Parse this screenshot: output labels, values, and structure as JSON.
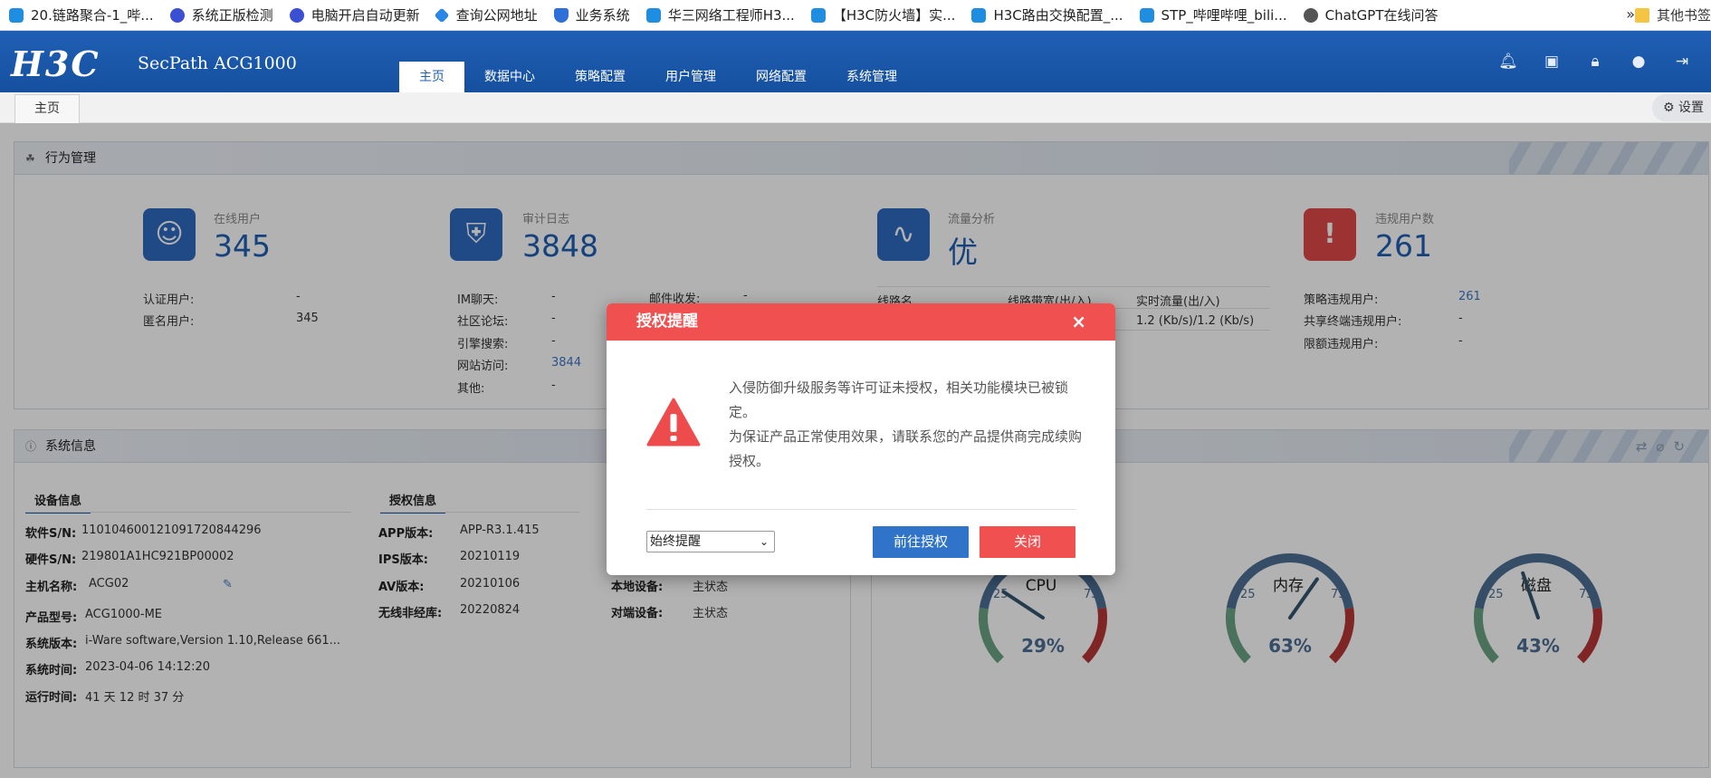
{
  "bookmarks": {
    "items": [
      {
        "label": "20.链路聚合-1_哔...",
        "icon": "bilibili-icon"
      },
      {
        "label": "系统正版检测",
        "icon": "baidu-paw-icon"
      },
      {
        "label": "电脑开启自动更新",
        "icon": "baidu-paw-icon"
      },
      {
        "label": "查询公网地址",
        "icon": "diamond-icon"
      },
      {
        "label": "业务系统",
        "icon": "shield-icon"
      },
      {
        "label": "华三网络工程师H3...",
        "icon": "bilibili-icon"
      },
      {
        "label": "【H3C防火墙】实...",
        "icon": "bilibili-icon"
      },
      {
        "label": "H3C路由交换配置_...",
        "icon": "bilibili-icon"
      },
      {
        "label": "STP_哔哩哔哩_bili...",
        "icon": "bilibili-icon"
      },
      {
        "label": "ChatGPT在线问答",
        "icon": "globe-icon"
      }
    ],
    "more": "»",
    "other": "其他书签"
  },
  "header": {
    "logo": "H3C",
    "product": "SecPath ACG1000",
    "nav": [
      "主页",
      "数据中心",
      "策略配置",
      "用户管理",
      "网络配置",
      "系统管理"
    ],
    "icons": [
      "bell-icon",
      "save-icon",
      "lock-icon",
      "user-icon",
      "logout-icon"
    ]
  },
  "tabbar": {
    "tab": "主页",
    "settings": "设置"
  },
  "behavior": {
    "title": "行为管理",
    "online_users": {
      "label": "在线用户",
      "value": "345",
      "rows": [
        {
          "k": "认证用户:",
          "v": "-"
        },
        {
          "k": "匿名用户:",
          "v": "345"
        }
      ]
    },
    "audit_log": {
      "label": "审计日志",
      "value": "3848",
      "rows": [
        {
          "k": "IM聊天:",
          "v": "-"
        },
        {
          "k": "社区论坛:",
          "v": "-"
        },
        {
          "k": "引擎搜索:",
          "v": "-"
        },
        {
          "k": "网站访问:",
          "v": "3844"
        },
        {
          "k": "其他:",
          "v": "-"
        }
      ],
      "mail": {
        "k": "邮件收发:",
        "v": "-"
      }
    },
    "traffic": {
      "label": "流量分析",
      "value": "优",
      "headers": [
        "线路名",
        "线路带宽(出/入)",
        "实时流量(出/入)"
      ],
      "row_value": "1.2 (Kb/s)/1.2 (Kb/s)"
    },
    "violations": {
      "label": "违规用户数",
      "value": "261",
      "rows": [
        {
          "k": "策略违规用户:",
          "v": "261"
        },
        {
          "k": "共享终端违规用户:",
          "v": "-"
        },
        {
          "k": "限额违规用户:",
          "v": "-"
        }
      ]
    }
  },
  "sysinfo": {
    "title": "系统信息",
    "device_tab": "设备信息",
    "license_tab": "授权信息",
    "device": [
      {
        "k": "软件S/N:",
        "v": "110104600121091720844296"
      },
      {
        "k": "硬件S/N:",
        "v": "219801A1HC921BP00002"
      },
      {
        "k": "主机名称:",
        "v": "ACG02"
      },
      {
        "k": "产品型号:",
        "v": "ACG1000-ME"
      },
      {
        "k": "系统版本:",
        "v": "i-Ware software,Version 1.10,Release 661..."
      },
      {
        "k": "系统时间:",
        "v": "2023-04-06 14:12:20"
      },
      {
        "k": "运行时间:",
        "v": "41 天 12 时 37 分"
      }
    ],
    "license": [
      {
        "k": "APP版本:",
        "v": "APP-R3.1.415"
      },
      {
        "k": "IPS版本:",
        "v": "20210119"
      },
      {
        "k": "AV版本:",
        "v": "20210106"
      },
      {
        "k": "无线非经库:",
        "v": "20220824"
      }
    ],
    "ha": [
      {
        "k": "本地设备:",
        "v": "主状态"
      },
      {
        "k": "对端设备:",
        "v": "主状态"
      }
    ]
  },
  "gauges": [
    {
      "name": "CPU",
      "value": 29,
      "text": "29%"
    },
    {
      "name": "内存",
      "value": 63,
      "text": "63%"
    },
    {
      "name": "磁盘",
      "value": 43,
      "text": "43%"
    }
  ],
  "gauge_ticks": [
    "25",
    "75"
  ],
  "modal": {
    "title": "授权提醒",
    "close": "×",
    "message1": "入侵防御升级服务等许可证未授权，相关功能模块已被锁定。",
    "message2": "为保证产品正常使用效果，请联系您的产品提供商完成续购授权。",
    "select_value": "始终提醒",
    "btn_go": "前往授权",
    "btn_close": "关闭"
  },
  "colors": {
    "brand": "#1f5fb4",
    "danger": "#f05050",
    "primary_btn": "#2f74c9"
  }
}
